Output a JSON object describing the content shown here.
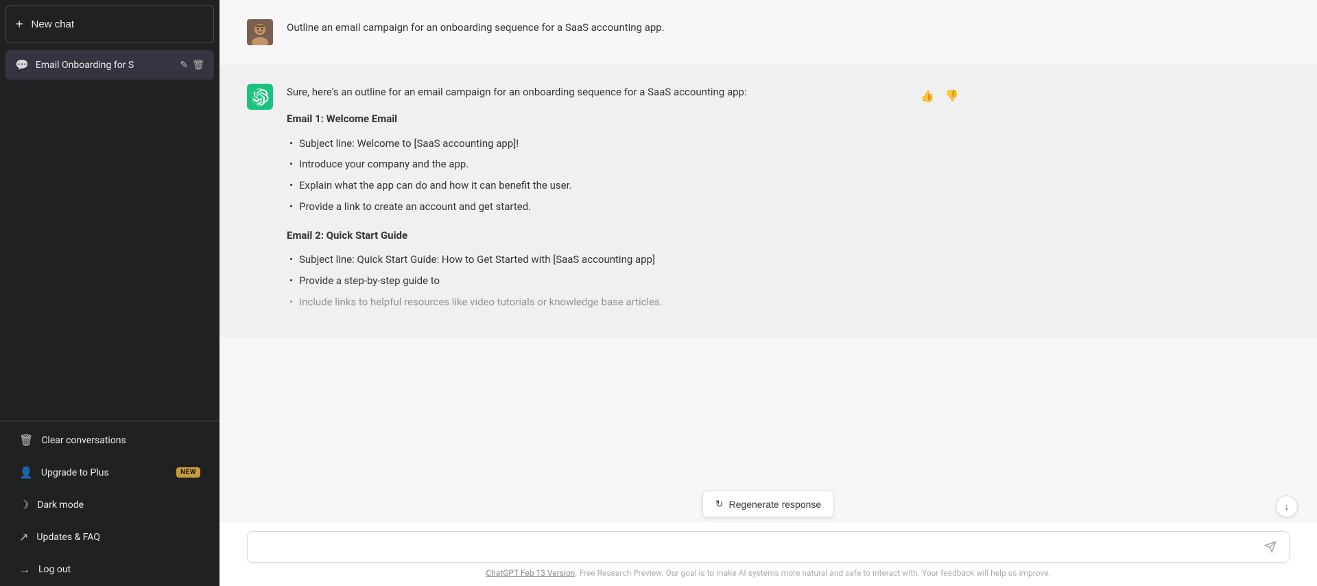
{
  "sidebar": {
    "new_chat_label": "New chat",
    "conversation": {
      "label": "Email Onboarding for S",
      "edit_icon": "✎",
      "delete_icon": "🗑"
    },
    "items": [
      {
        "id": "clear",
        "icon": "🗑",
        "label": "Clear conversations"
      },
      {
        "id": "upgrade",
        "icon": "👤",
        "label": "Upgrade to Plus",
        "badge": "NEW"
      },
      {
        "id": "darkmode",
        "icon": "☽",
        "label": "Dark mode"
      },
      {
        "id": "updates",
        "icon": "↗",
        "label": "Updates & FAQ"
      },
      {
        "id": "logout",
        "icon": "→",
        "label": "Log out"
      }
    ]
  },
  "messages": [
    {
      "role": "user",
      "text": "Outline an email campaign for an onboarding sequence for a SaaS accounting app."
    },
    {
      "role": "assistant",
      "intro": "Sure, here's an outline for an email campaign for an onboarding sequence for a SaaS accounting app:",
      "emails": [
        {
          "heading": "Email 1: Welcome Email",
          "bullets": [
            "Subject line: Welcome to [SaaS accounting app]!",
            "Introduce your company and the app.",
            "Explain what the app can do and how it can benefit the user.",
            "Provide a link to create an account and get started."
          ]
        },
        {
          "heading": "Email 2: Quick Start Guide",
          "bullets": [
            "Subject line: Quick Start Guide: How to Get Started with [SaaS accounting app]",
            "Provide a step-by-step guide to",
            "Include links to helpful resources like video tutorials or knowledge base articles."
          ]
        }
      ]
    }
  ],
  "regenerate_label": "Regenerate response",
  "input_placeholder": "",
  "footer": {
    "link_text": "ChatGPT Feb 13 Version",
    "description": ". Free Research Preview. Our goal is to make AI systems more natural and safe to interact with. Your feedback will help us improve."
  }
}
